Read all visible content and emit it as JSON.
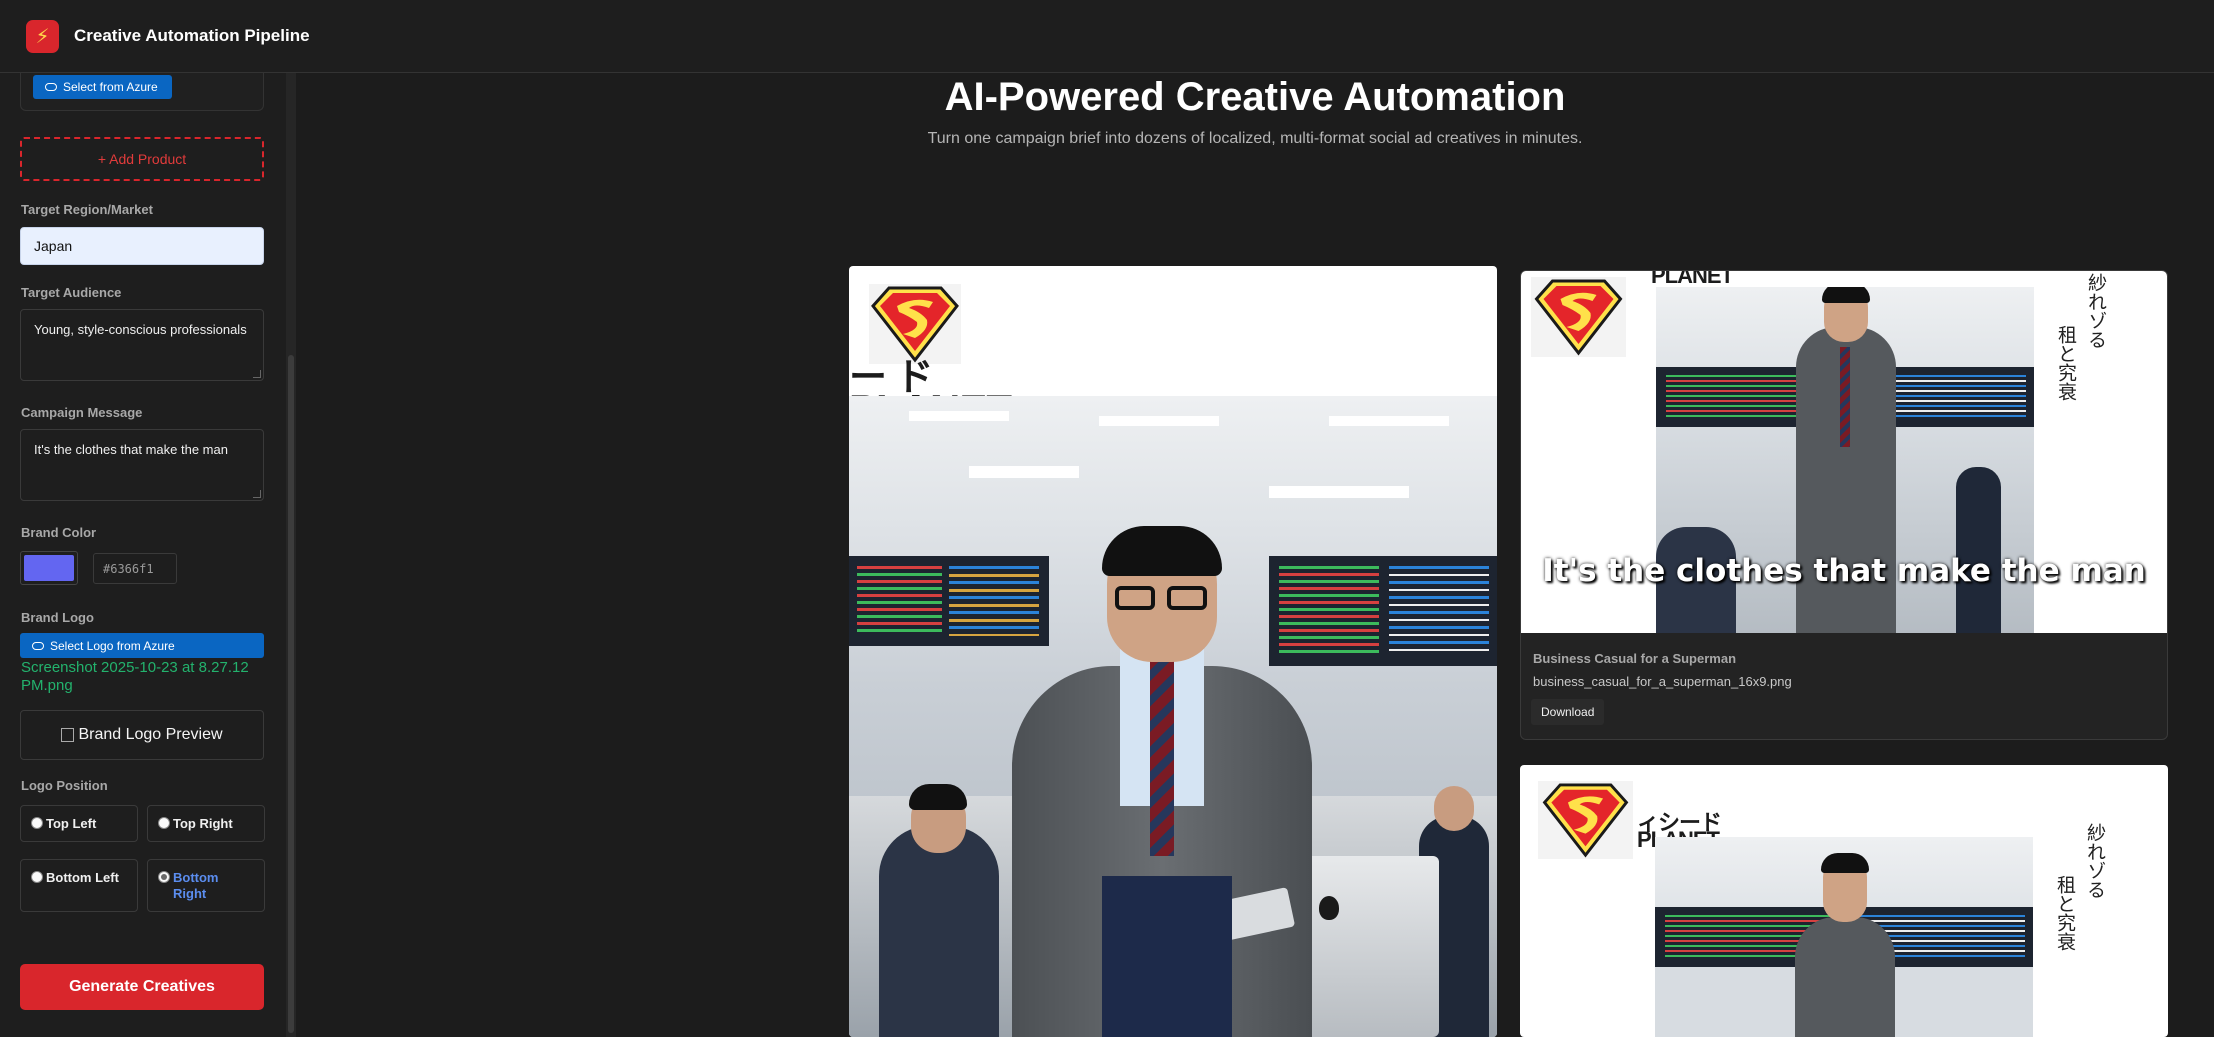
{
  "header": {
    "app_title": "Creative Automation Pipeline",
    "icon": "lightning-bolt-icon"
  },
  "sidebar": {
    "select_azure_label": "Select from Azure",
    "add_product_label": "+ Add Product",
    "region_label": "Target Region/Market",
    "region_value": "Japan",
    "audience_label": "Target Audience",
    "audience_value": "Young, style-conscious professionals",
    "message_label": "Campaign Message",
    "message_value": "It's the clothes that make the man",
    "brand_color_label": "Brand Color",
    "brand_color_value": "#6366f1",
    "brand_logo_label": "Brand Logo",
    "select_logo_label": "Select Logo from Azure",
    "logo_filename": "Screenshot 2025-10-23 at 8.27.12 PM.png",
    "logo_preview_alt": "Brand Logo Preview",
    "logo_position_label": "Logo Position",
    "positions": [
      "Top Left",
      "Top Right",
      "Bottom Left",
      "Bottom Right"
    ],
    "selected_position": "Bottom Right",
    "generate_label": "Generate Creatives"
  },
  "main": {
    "hero_title": "AI-Powered Creative Automation",
    "hero_subtitle": "Turn one campaign brief into dozens of localized, multi-format social ad creatives in minutes.",
    "results": [
      {
        "title": "Business Casual for a Superman",
        "filename": "business_casual_for_a_superman_16x9.png",
        "download_label": "Download",
        "overlay": "It's the clothes that make the man"
      }
    ],
    "creative_text": {
      "planet": "PLANET",
      "katakana_large": "ィシード",
      "katakana_partial": "ー ド",
      "japanese_vertical_1": "紗れゾる",
      "japanese_vertical_2": "租と究衰"
    }
  },
  "colors": {
    "accent": "#d9262c",
    "azure": "#0a66c2",
    "success": "#23b26d",
    "brand": "#6366f1"
  }
}
